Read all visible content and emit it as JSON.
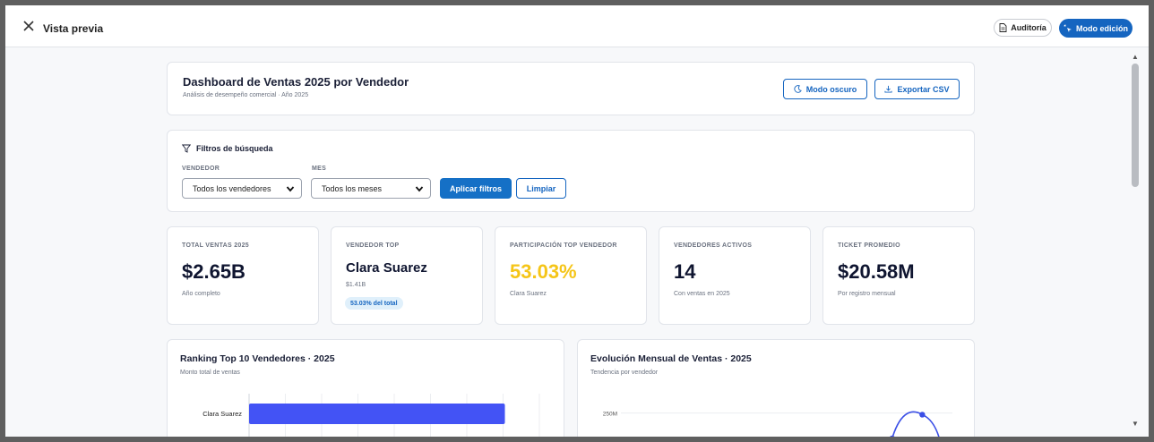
{
  "modal": {
    "title": "Vista previa",
    "audit_label": "Auditoría",
    "edit_label": "Modo edición"
  },
  "header_card": {
    "title": "Dashboard de Ventas 2025 por Vendedor",
    "subtitle": "Análisis de desempeño comercial · Año 2025",
    "dark_mode_label": "Modo oscuro",
    "export_label": "Exportar CSV"
  },
  "filters": {
    "title": "Filtros de búsqueda",
    "seller_label": "VENDEDOR",
    "seller_value": "Todos los vendedores",
    "month_label": "MES",
    "month_value": "Todos los meses",
    "apply_label": "Aplicar filtros",
    "clear_label": "Limpiar"
  },
  "kpis": [
    {
      "label": "TOTAL VENTAS 2025",
      "value": "$2.65B",
      "note": "Año completo",
      "color": "#0f1530"
    },
    {
      "label": "VENDEDOR TOP",
      "value": "Clara Suarez",
      "amount": "$1.41B",
      "badge": "53.03% del total",
      "color": "#0f1530"
    },
    {
      "label": "PARTICIPACIÓN TOP VENDEDOR",
      "value": "53.03%",
      "note": "Clara Suarez",
      "color": "#f5c518"
    },
    {
      "label": "VENDEDORES ACTIVOS",
      "value": "14",
      "note": "Con ventas en 2025",
      "color": "#0f1530"
    },
    {
      "label": "TICKET PROMEDIO",
      "value": "$20.58M",
      "note": "Por registro mensual",
      "color": "#0f1530"
    }
  ],
  "ranking": {
    "title": "Ranking Top 10 Vendedores · 2025",
    "subtitle": "Monto total de ventas"
  },
  "evolution": {
    "title": "Evolución Mensual de Ventas · 2025",
    "subtitle": "Tendencia por vendedor"
  },
  "chart_data": [
    {
      "type": "bar",
      "orientation": "horizontal",
      "categories": [
        "Clara Suarez"
      ],
      "values": [
        1.41
      ],
      "unit": "B",
      "xlim": [
        0,
        1.6
      ],
      "color": "#4353f5"
    },
    {
      "type": "line",
      "y_ticks": [
        "250M",
        "200M"
      ],
      "series": [
        {
          "color": "#3b4fe6",
          "points": [
            {
              "x": 10,
              "y": 218
            },
            {
              "x": 11,
              "y": 248
            }
          ]
        }
      ],
      "x_range": [
        1,
        12
      ],
      "ylim": [
        150,
        270
      ]
    }
  ]
}
